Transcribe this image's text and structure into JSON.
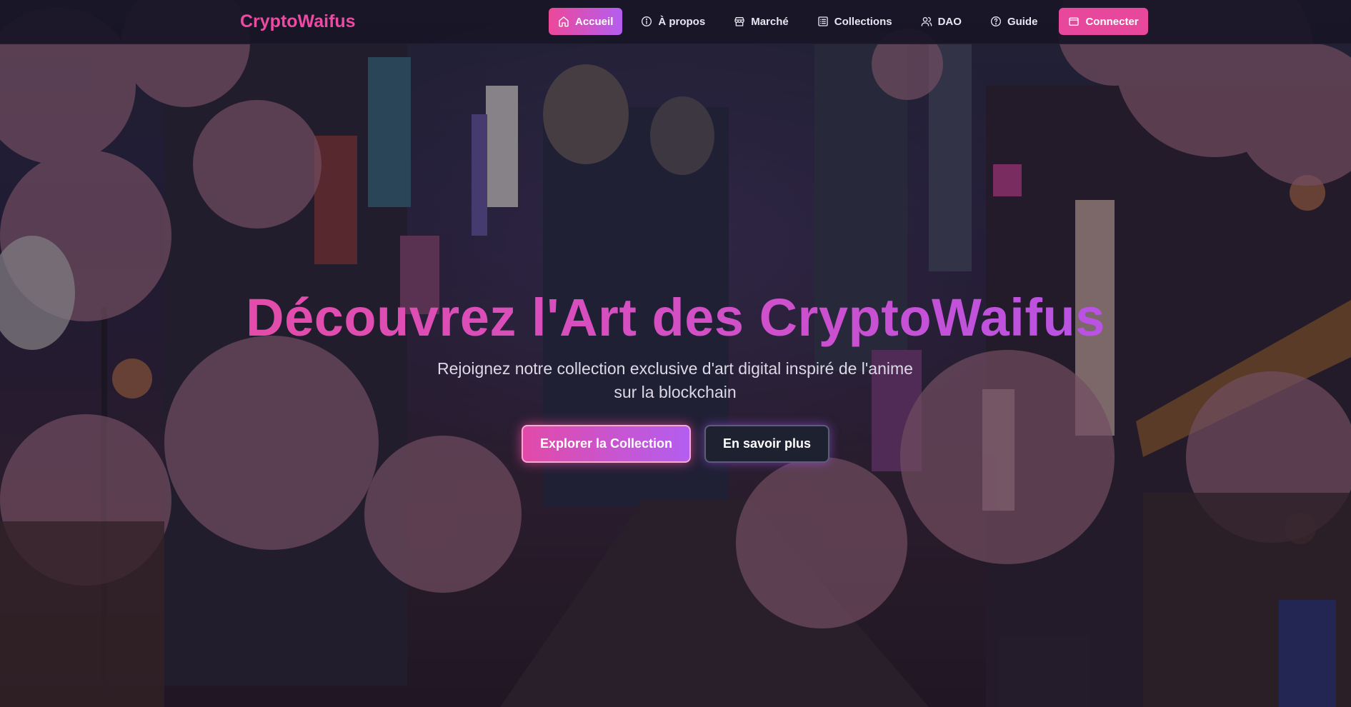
{
  "brand": {
    "name": "CryptoWaifus"
  },
  "nav": {
    "items": [
      {
        "label": "Accueil",
        "icon": "home-icon",
        "active": true
      },
      {
        "label": "À propos",
        "icon": "info-icon",
        "active": false
      },
      {
        "label": "Marché",
        "icon": "store-icon",
        "active": false
      },
      {
        "label": "Collections",
        "icon": "collections-icon",
        "active": false
      },
      {
        "label": "DAO",
        "icon": "users-icon",
        "active": false
      },
      {
        "label": "Guide",
        "icon": "help-circle-icon",
        "active": false
      }
    ],
    "connect_label": "Connecter",
    "connect_icon": "wallet-icon"
  },
  "hero": {
    "title": "Découvrez l'Art des CryptoWaifus",
    "subtitle": "Rejoignez notre collection exclusive d'art digital inspiré de l'anime sur la blockchain",
    "primary_button": "Explorer la Collection",
    "secondary_button": "En savoir plus"
  },
  "colors": {
    "accent_pink": "#ec4899",
    "accent_purple": "#a855f7",
    "navbar_bg": "#181626",
    "secondary_button_bg": "#1e2130"
  }
}
